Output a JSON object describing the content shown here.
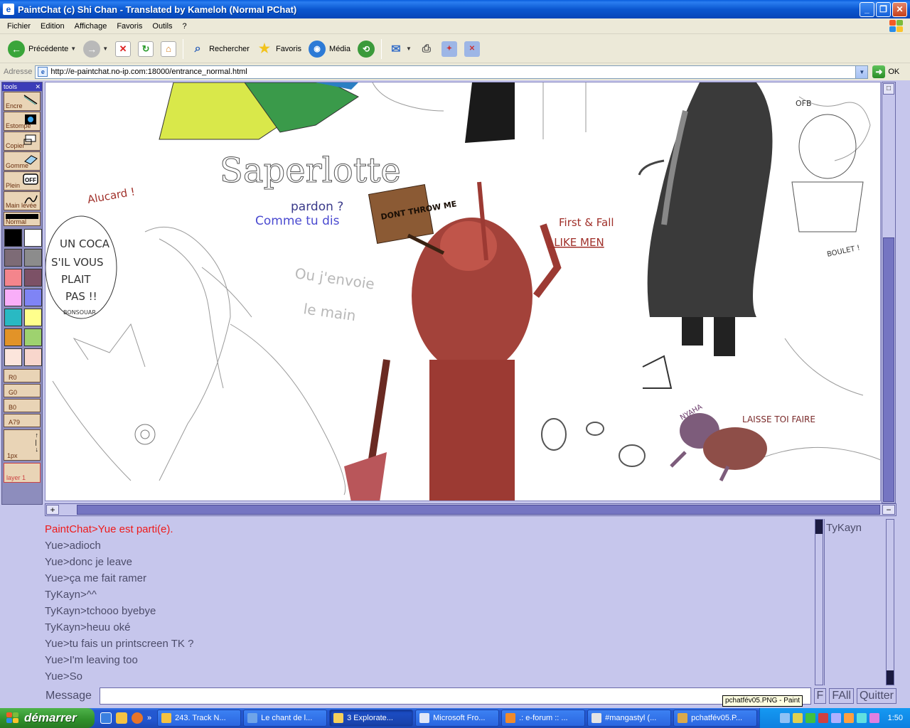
{
  "window": {
    "title": "PaintChat (c) Shi Chan - Translated by Kameloh (Normal PChat)"
  },
  "menu": [
    "Fichier",
    "Edition",
    "Affichage",
    "Favoris",
    "Outils",
    "?"
  ],
  "toolbar": {
    "back": "Précédente",
    "search": "Rechercher",
    "favorites": "Favoris",
    "media": "Média"
  },
  "address": {
    "label": "Adresse",
    "url": "http://e-paintchat.no-ip.com:18000/entrance_normal.html",
    "go": "OK"
  },
  "tools": {
    "header": "tools",
    "items": [
      "Encre",
      "Estompe",
      "Copier",
      "Gomme",
      "Plein",
      "Main levée"
    ],
    "mode": "Normal",
    "rgba": [
      "R0",
      "G0",
      "B0",
      "A79"
    ],
    "size": "1px",
    "layer": "layer 1",
    "swatches": [
      "#000000",
      "#ffffff",
      "#7d6b76",
      "#8c8c8c",
      "#f4858c",
      "#7c5166",
      "#f9aef9",
      "#7f84f5",
      "#29b9c3",
      "#ffff8c",
      "#e29328",
      "#9ed26f",
      "#fce5dc",
      "#f8d6cc"
    ]
  },
  "canvas": {
    "texts": [
      "Saperlotte",
      "pardon ?",
      "Comme tu dis",
      "Alucard !",
      "UN COCA",
      "S'IL VOUS",
      "PLAIT",
      "PAS !!",
      "BONSOUAR",
      "Ou j'envoie",
      "le main",
      "DONT THROW ME",
      "First & Fall",
      "I LIKE MEN",
      "OFB",
      "BOULET !",
      "LAISSE TOI FAIRE",
      "NYAHA"
    ]
  },
  "chat": {
    "lines": [
      {
        "text": "PaintChat>Yue est parti(e).",
        "system": true
      },
      {
        "text": "Yue>adioch",
        "system": false
      },
      {
        "text": "Yue>donc je leave",
        "system": false
      },
      {
        "text": "Yue>ça me fait ramer",
        "system": false
      },
      {
        "text": "TyKayn>^^",
        "system": false
      },
      {
        "text": "TyKayn>tchooo byebye",
        "system": false
      },
      {
        "text": "TyKayn>heuu oké",
        "system": false
      },
      {
        "text": "Yue>tu fais un printscreen TK ?",
        "system": false
      },
      {
        "text": "Yue>I'm leaving too",
        "system": false
      },
      {
        "text": "Yue>So",
        "system": false
      }
    ],
    "users": [
      "TyKayn"
    ],
    "message_label": "Message",
    "message_value": "",
    "buttons": {
      "f": "F",
      "fall": "FAll",
      "quit": "Quitter"
    }
  },
  "tooltip": "pchatfév05.PNG - Paint",
  "taskbar": {
    "start": "démarrer",
    "tasks": [
      {
        "label": "243. Track N...",
        "color": "#f5c242",
        "active": false
      },
      {
        "label": "Le chant de l...",
        "color": "#6fa4e8",
        "active": false
      },
      {
        "label": "3 Explorate...",
        "color": "#f5cf5a",
        "active": true
      },
      {
        "label": "Microsoft Fro...",
        "color": "#dfe6f7",
        "active": false
      },
      {
        "label": ".: e-forum :: ...",
        "color": "#f08a2b",
        "active": false
      },
      {
        "label": "#mangastyl (...",
        "color": "#e4e4e4",
        "active": false
      },
      {
        "label": "pchatfév05.P...",
        "color": "#d9a94c",
        "active": false
      }
    ],
    "clock": "1:50"
  },
  "colors": {
    "applet_bg": "#c6c6ec",
    "system_message": "#ee1a1a",
    "chat_text": "#4c4c6a"
  }
}
